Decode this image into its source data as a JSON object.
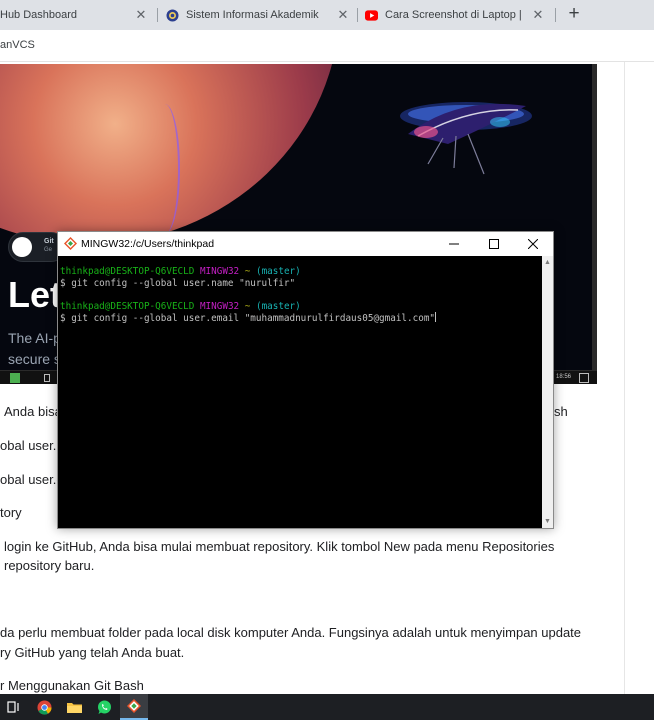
{
  "browser": {
    "tabs": [
      {
        "title": "Hub Dashboard",
        "icon": "github-icon"
      },
      {
        "title": "Sistem Informasi Akademik",
        "icon": "university-seal-icon"
      },
      {
        "title": "Cara Screenshot di Laptop | Foto",
        "icon": "youtube-icon"
      }
    ],
    "bookmark": "anVCS"
  },
  "hero": {
    "headline": "Let",
    "sub_line1": "The AI-p",
    "sub_line2": "secure s",
    "badge_title": "Git",
    "badge_sub": "Ge",
    "tray_time": "18:56"
  },
  "terminal": {
    "title": "MINGW32:/c/Users/thinkpad",
    "prompt_user": "thinkpad@DESKTOP-Q6VECLD",
    "prompt_env": "MINGW32",
    "prompt_path": "~",
    "prompt_branch": "(master)",
    "cmd1": "$ git config --global user.name \"nurulfir\"",
    "cmd2": "$ git config --global user.email \"muhammadnurulfirdaus05@gmail.com\""
  },
  "article": {
    "p1_start": "Anda bisa",
    "p1_end": "sh",
    "code1": "obal user.n",
    "code2": "obal user.e",
    "heading1": "tory",
    "p2_line1": "login ke GitHub, Anda bisa mulai membuat repository. Klik tombol New pada menu Repositories",
    "p2_line2": "repository baru.",
    "p3_line1": "da perlu membuat folder pada local disk komputer Anda. Fungsinya adalah untuk menyimpan update",
    "p3_line2": "ry GitHub yang telah Anda buat.",
    "heading2": "r Menggunakan Git Bash"
  },
  "taskbar": {
    "items": [
      "task-view-icon",
      "chrome-icon",
      "file-explorer-icon",
      "whatsapp-icon",
      "git-bash-icon"
    ]
  },
  "colors": {
    "terminal_green": "#18b218",
    "terminal_magenta": "#c41fc4",
    "terminal_yellow": "#b2b218",
    "terminal_cyan": "#18b2b2",
    "taskbar_bg": "#1d1f23"
  }
}
